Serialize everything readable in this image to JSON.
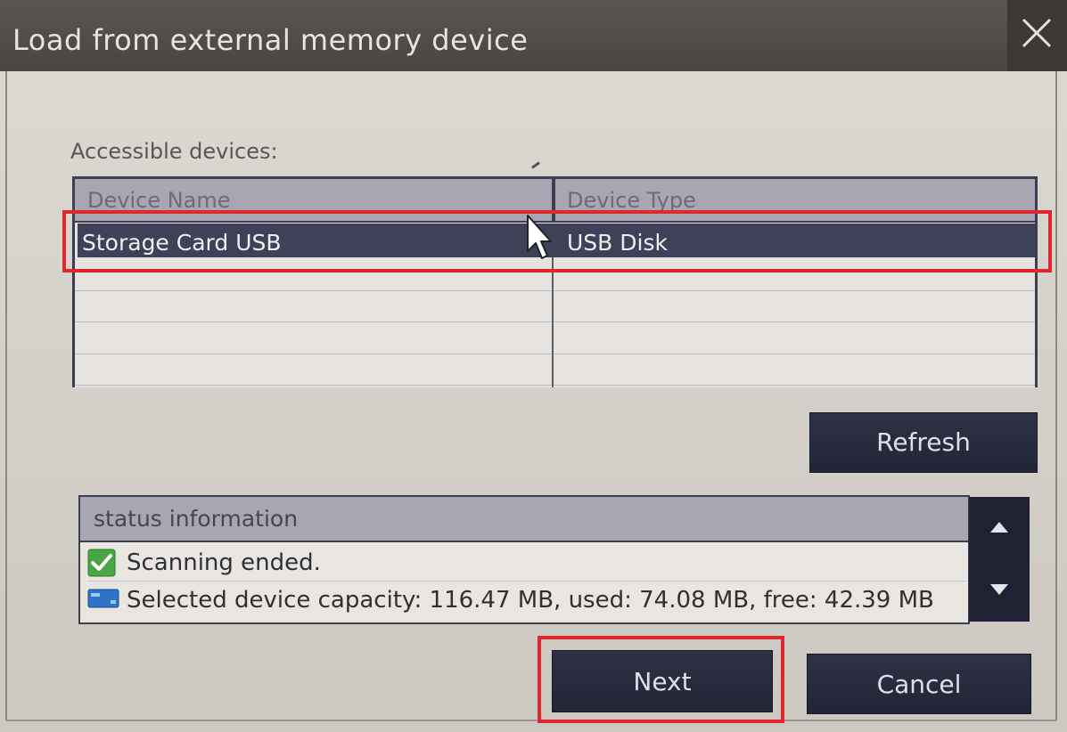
{
  "window": {
    "title": "Load from external memory device",
    "close_icon": "close-icon"
  },
  "devices": {
    "label": "Accessible devices:",
    "columns": [
      "Device Name",
      "Device Type"
    ],
    "rows": [
      {
        "name": "Storage Card USB",
        "type": "USB Disk",
        "selected": true
      }
    ]
  },
  "buttons": {
    "refresh": "Refresh",
    "next": "Next",
    "cancel": "Cancel"
  },
  "status": {
    "header": "status information",
    "messages": [
      {
        "icon": "check-icon",
        "text": "Scanning ended."
      },
      {
        "icon": "storage-device-icon",
        "text": "Selected device capacity: 116.47 MB, used: 74.08 MB, free: 42.39 MB"
      }
    ],
    "scroll_up_icon": "scroll-up-icon",
    "scroll_down_icon": "scroll-down-icon"
  },
  "colors": {
    "highlight": "#e0262e",
    "selected_row": "#3e4157",
    "button": "#2a2d40",
    "titlebar": "#524d49"
  }
}
